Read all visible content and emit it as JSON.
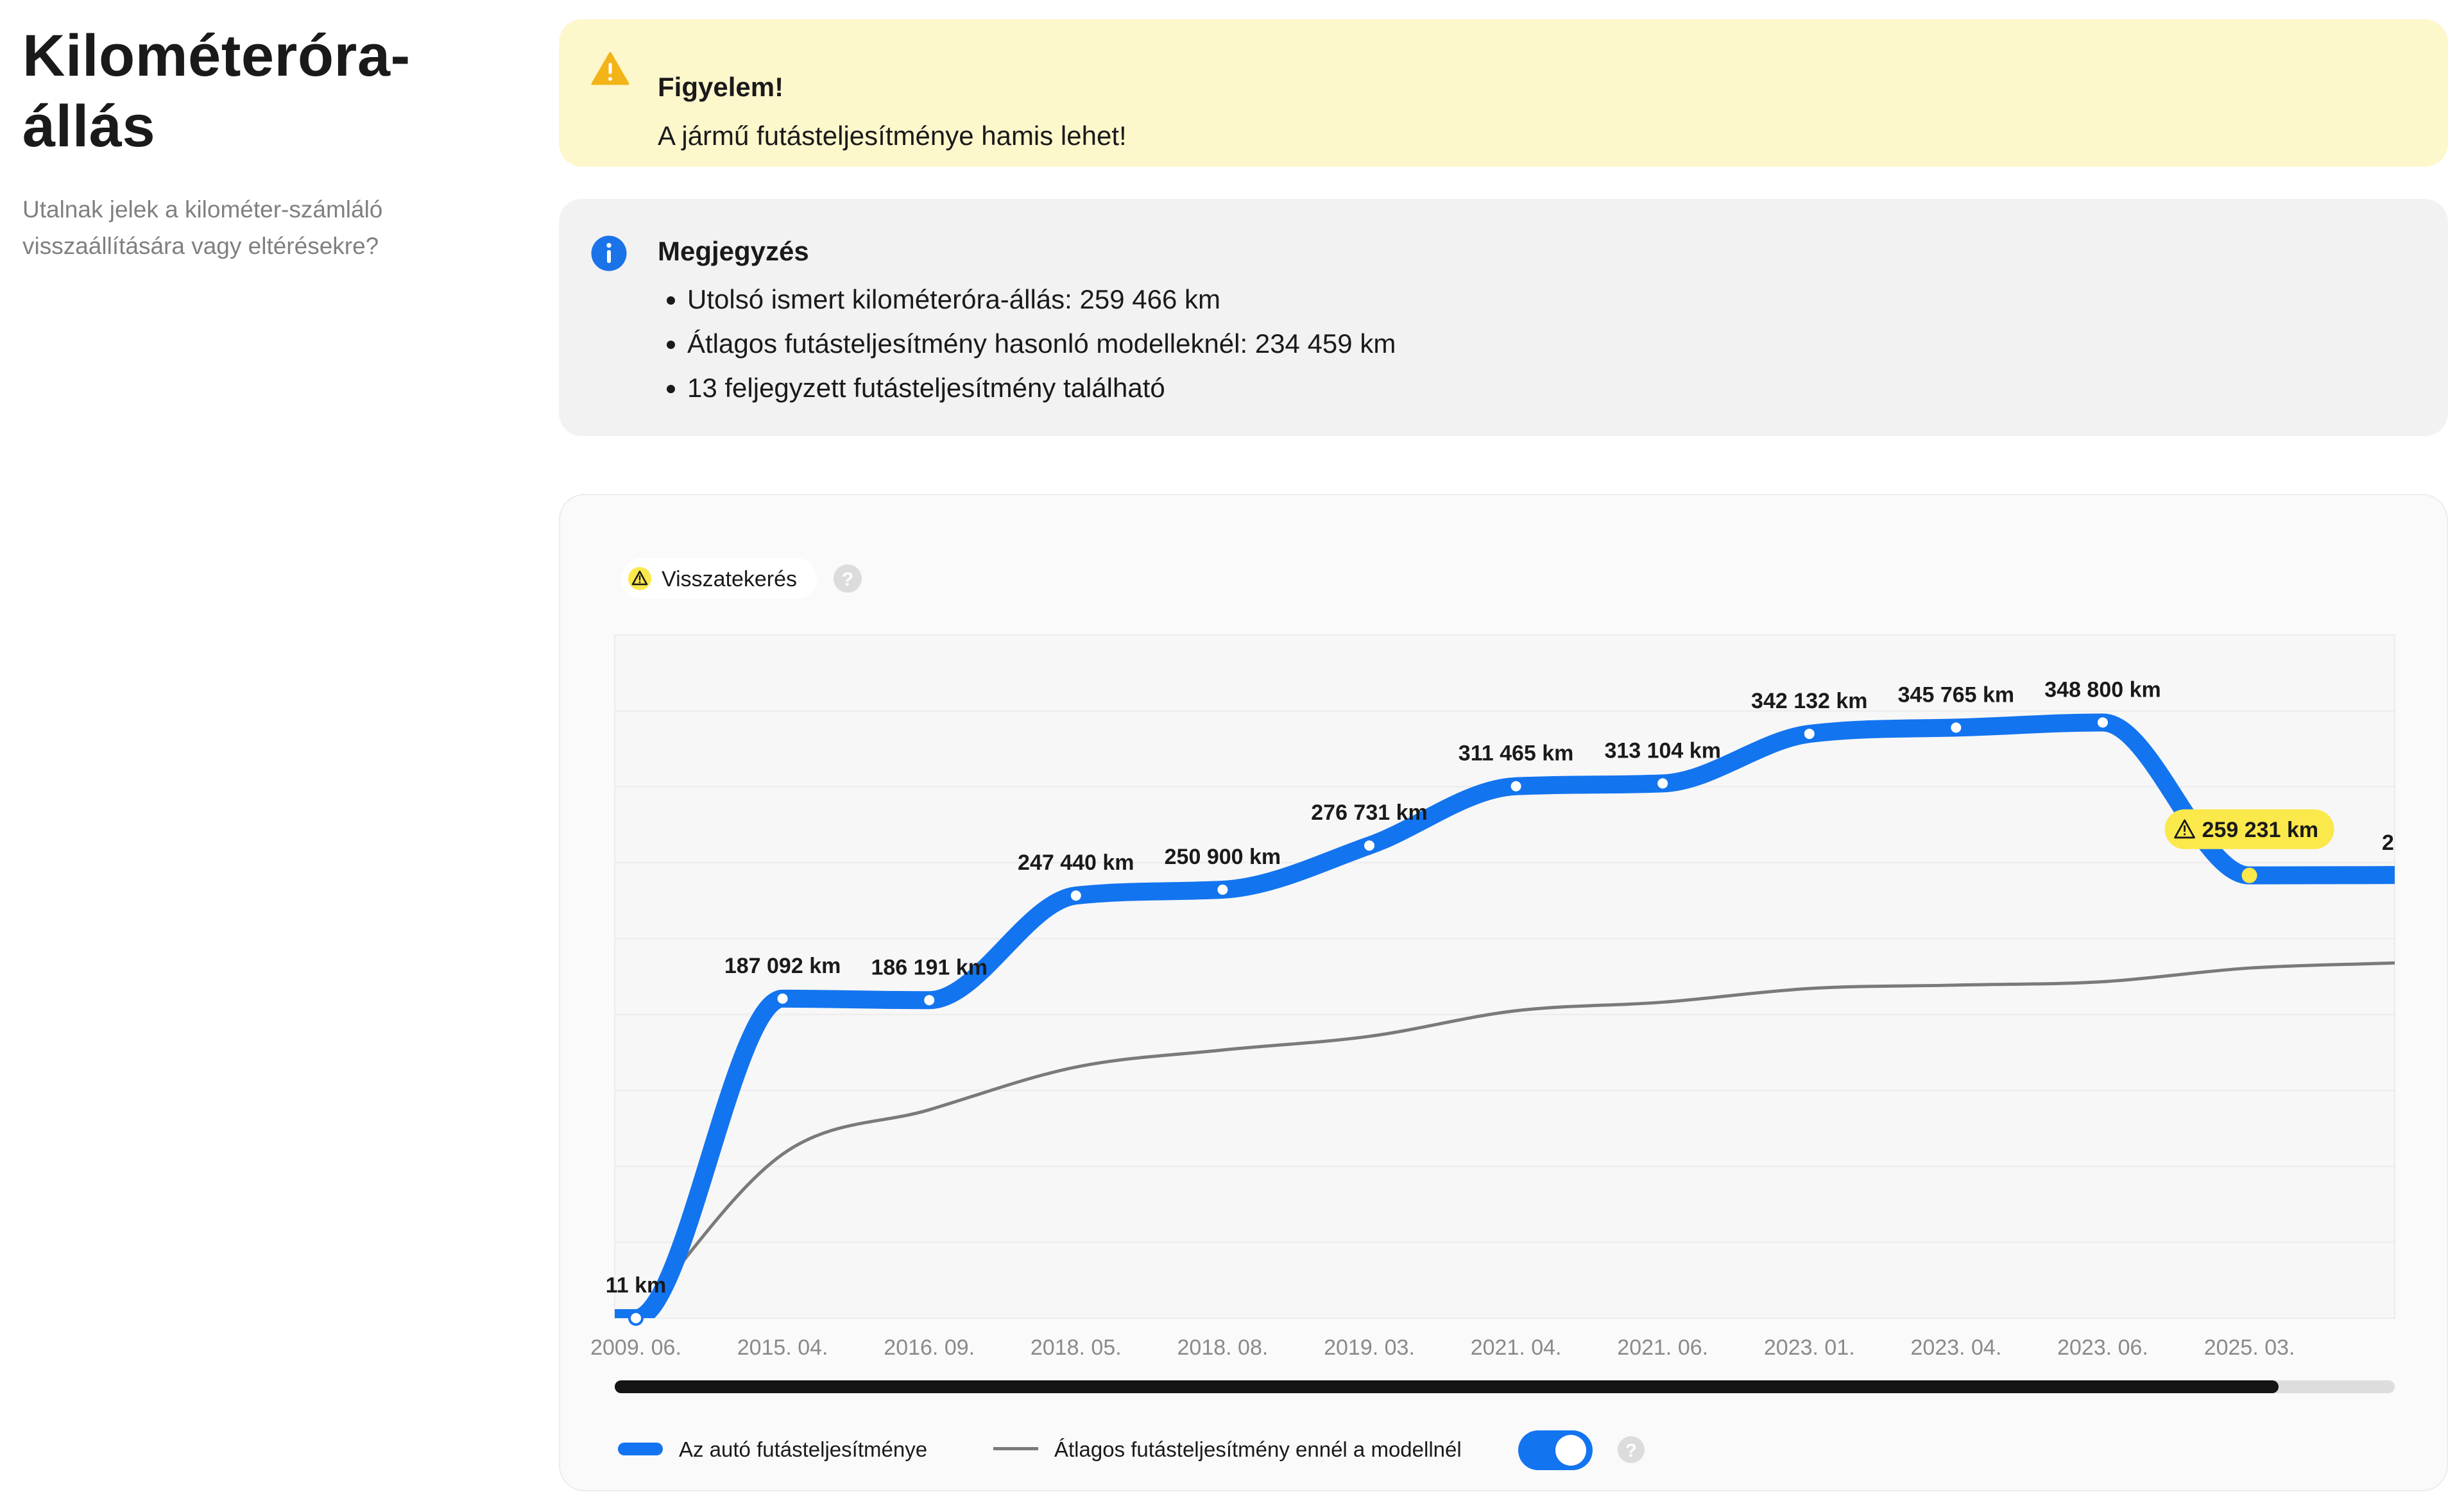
{
  "page": {
    "title": "Kilométeróra-állás",
    "subtitle": "Utalnak jelek a kilométer-számláló visszaállítására vagy eltérésekre?"
  },
  "alert": {
    "icon": "warning-triangle-icon",
    "title": "Figyelem!",
    "text": "A jármű futásteljesítménye hamis lehet!",
    "color": "#f3b418",
    "background": "#fdf7cc"
  },
  "note": {
    "icon": "info-circle-icon",
    "title": "Megjegyzés",
    "items": [
      "Utolsó ismert kilométeróra-állás: 259 466 km",
      "Átlagos futásteljesítmény hasonló modelleknél: 234 459 km",
      "13 feljegyzett futásteljesítmény található"
    ],
    "color": "#1a73e8"
  },
  "chart": {
    "rollback_chip": {
      "label": "Visszatekerés",
      "icon": "warning-triangle-icon"
    },
    "help_icon": "question-circle-icon",
    "legend": {
      "car_label": "Az autó futásteljesítménye",
      "avg_label": "Átlagos futásteljesítmény ennél a modellnél",
      "avg_toggle_on": true
    },
    "colors": {
      "car": "#1374ef",
      "avg": "#7a7a7a",
      "warning": "#fbe84a"
    }
  },
  "chart_data": {
    "type": "line",
    "categories": [
      "2009. 06.",
      "2015. 04.",
      "2016. 09.",
      "2018. 05.",
      "2018. 08.",
      "2019. 03.",
      "2021. 04.",
      "2021. 06.",
      "2023. 01.",
      "2023. 04.",
      "2023. 06.",
      "2025. 03."
    ],
    "series": [
      {
        "name": "Az autó futásteljesítménye",
        "values": [
          11,
          187092,
          186191,
          247440,
          250900,
          276731,
          311465,
          313104,
          342132,
          345765,
          348800,
          259231
        ],
        "labels": [
          "11 km",
          "187 092 km",
          "186 191 km",
          "247 440 km",
          "250 900 km",
          "276 731 km",
          "311 465 km",
          "313 104 km",
          "342 132 km",
          "345 765 km",
          "348 800 km",
          "259 231 km"
        ],
        "trailing_value": 259466,
        "trailing_label_partial": "2"
      },
      {
        "name": "Átlagos futásteljesítmény ennél a modellnél",
        "values": [
          11,
          96000,
          122000,
          147000,
          157000,
          165000,
          180000,
          185000,
          193000,
          195000,
          197000,
          205000
        ],
        "trailing_value": 208000
      }
    ],
    "ylim": [
      0,
      400000
    ],
    "grid": true,
    "highlight": {
      "category": "2025. 03.",
      "label": "259 231 km",
      "type": "rollback"
    }
  }
}
